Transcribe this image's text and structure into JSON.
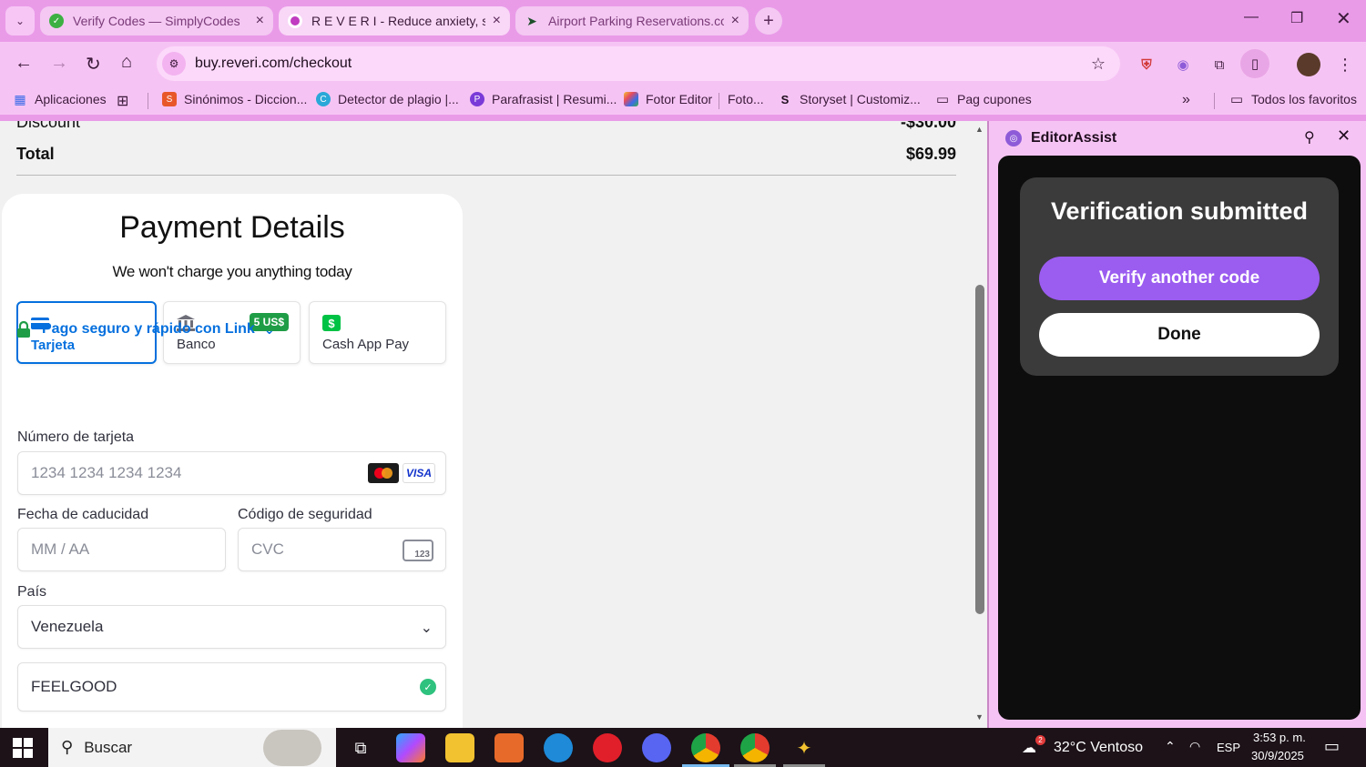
{
  "browser": {
    "tabs": [
      {
        "title": "Verify Codes — SimplyCodes",
        "active": false
      },
      {
        "title": "R E V E R I - Reduce anxiety, sleep",
        "active": true
      },
      {
        "title": "Airport Parking Reservations.com",
        "active": false
      }
    ],
    "url": "buy.reveri.com/checkout",
    "bookmarks": [
      {
        "label": "Aplicaciones"
      },
      {
        "label": "Sinónimos - Diccion..."
      },
      {
        "label": "Detector de plagio |..."
      },
      {
        "label": "Parafrasist | Resumi..."
      },
      {
        "label": "Fotor Editor"
      },
      {
        "label": "Foto..."
      },
      {
        "label": "Storyset | Customiz..."
      },
      {
        "label": "Pag cupones"
      }
    ],
    "all_bookmarks": "Todos los favoritos"
  },
  "summary": {
    "discount_label": "Discount",
    "discount_value": "-$30.00",
    "total_label": "Total",
    "total_value": "$69.99"
  },
  "payment": {
    "title": "Payment Details",
    "subtitle": "We won't charge you anything today",
    "methods": [
      {
        "label": "Tarjeta",
        "selected": true
      },
      {
        "label": "Banco",
        "badge": "5 US$"
      },
      {
        "label": "Cash App Pay",
        "icon_text": "$"
      }
    ],
    "link_text": "Pago seguro y rápido con Link",
    "card_number_label": "Número de tarjeta",
    "card_number_placeholder": "1234 1234 1234 1234",
    "visa": "VISA",
    "expiry_label": "Fecha de caducidad",
    "expiry_placeholder": "MM / AA",
    "cvc_label": "Código de seguridad",
    "cvc_placeholder": "CVC",
    "cvc_icon_text": "123",
    "country_label": "País",
    "country_value": "Venezuela",
    "promo_value": "FEELGOOD"
  },
  "sidepanel": {
    "title": "EditorAssist",
    "heading": "Verification submitted",
    "verify_another": "Verify another code",
    "done": "Done"
  },
  "taskbar": {
    "search": "Buscar",
    "weather": "32°C  Ventoso",
    "weather_badge": "2",
    "lang": "ESP",
    "time": "3:53 p. m.",
    "date": "30/9/2025"
  },
  "colors": {
    "chrome": "#e99be8",
    "accent": "#8e5bd8",
    "stripe_blue": "#0570de",
    "badge_green": "#1f9d46"
  }
}
